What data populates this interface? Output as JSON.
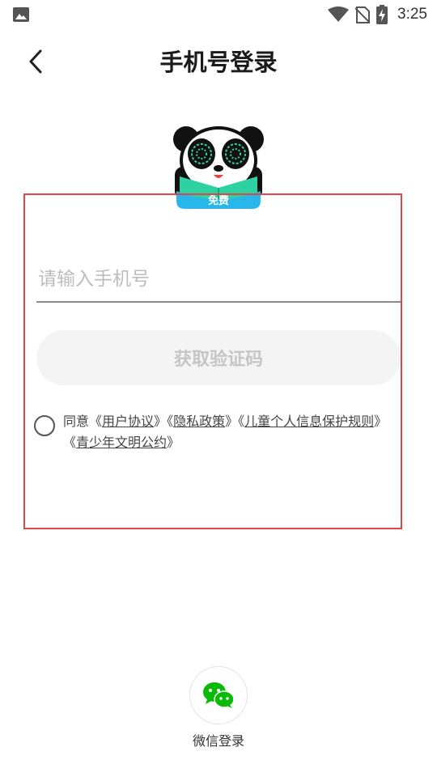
{
  "status_bar": {
    "time": "3:25",
    "icons": [
      "gallery-icon",
      "wifi-icon",
      "no-sim-icon",
      "battery-charging-icon"
    ]
  },
  "header": {
    "title": "手机号登录",
    "back_icon": "back-chevron-icon"
  },
  "mascot": {
    "badge": "免费",
    "icon": "panda-mascot-icon"
  },
  "form": {
    "phone_placeholder": "请输入手机号",
    "phone_value": "",
    "get_code_label": "获取验证码",
    "agreement": {
      "checked": false,
      "prefix": "同意",
      "links": [
        "用户协议",
        "隐私政策",
        "儿童个人信息保护规则",
        "青少年文明公约"
      ],
      "open_bracket": "《",
      "close_bracket": "》"
    }
  },
  "third_party": {
    "wechat_label": "微信登录",
    "wechat_icon": "wechat-icon"
  },
  "colors": {
    "highlight": "#e0474c",
    "wechat_green": "#09bb07",
    "button_bg": "#f4f4f4",
    "badge_blue": "#29b6e8",
    "mascot_green": "#2ed1a2"
  }
}
